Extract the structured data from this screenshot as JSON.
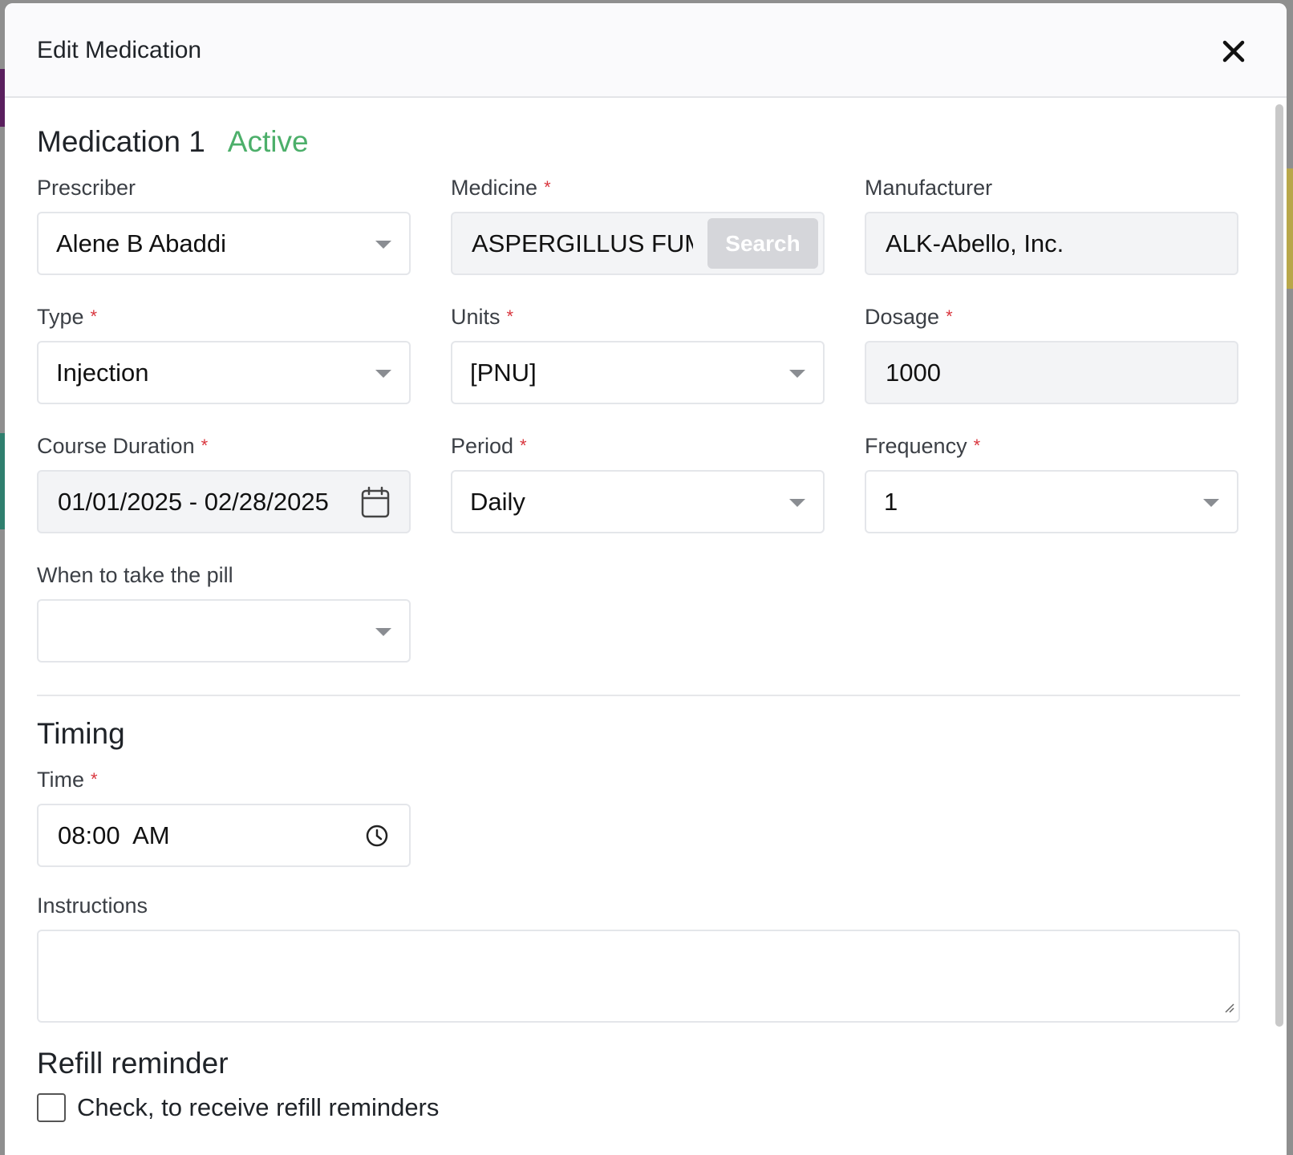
{
  "modal": {
    "title": "Edit Medication",
    "close_icon": "close-icon"
  },
  "medication": {
    "heading": "Medication 1",
    "status": "Active",
    "status_color": "#4caf6a"
  },
  "fields": {
    "prescriber": {
      "label": "Prescriber",
      "value": "Alene B Abaddi"
    },
    "medicine": {
      "label": "Medicine",
      "value": "ASPERGILLUS FUMIGATUS",
      "button": "Search"
    },
    "manufacturer": {
      "label": "Manufacturer",
      "value": "ALK-Abello, Inc."
    },
    "type": {
      "label": "Type",
      "value": "Injection"
    },
    "units": {
      "label": "Units",
      "value": "[PNU]"
    },
    "dosage": {
      "label": "Dosage",
      "value": "1000"
    },
    "course_duration": {
      "label": "Course Duration",
      "value": "01/01/2025 - 02/28/2025"
    },
    "period": {
      "label": "Period",
      "value": "Daily"
    },
    "frequency": {
      "label": "Frequency",
      "value": "1"
    },
    "when_to_take": {
      "label": "When to take the pill",
      "value": ""
    }
  },
  "timing": {
    "heading": "Timing",
    "time_label": "Time",
    "time_value": "08:00  AM"
  },
  "instructions": {
    "label": "Instructions",
    "value": ""
  },
  "refill": {
    "heading": "Refill reminder",
    "checkbox_label": "Check, to receive refill reminders",
    "checked": false
  },
  "required_marker": "*",
  "colors": {
    "required": "#d9363e",
    "header_bg": "#fafafc",
    "search_button_bg": "#d5d6da"
  }
}
